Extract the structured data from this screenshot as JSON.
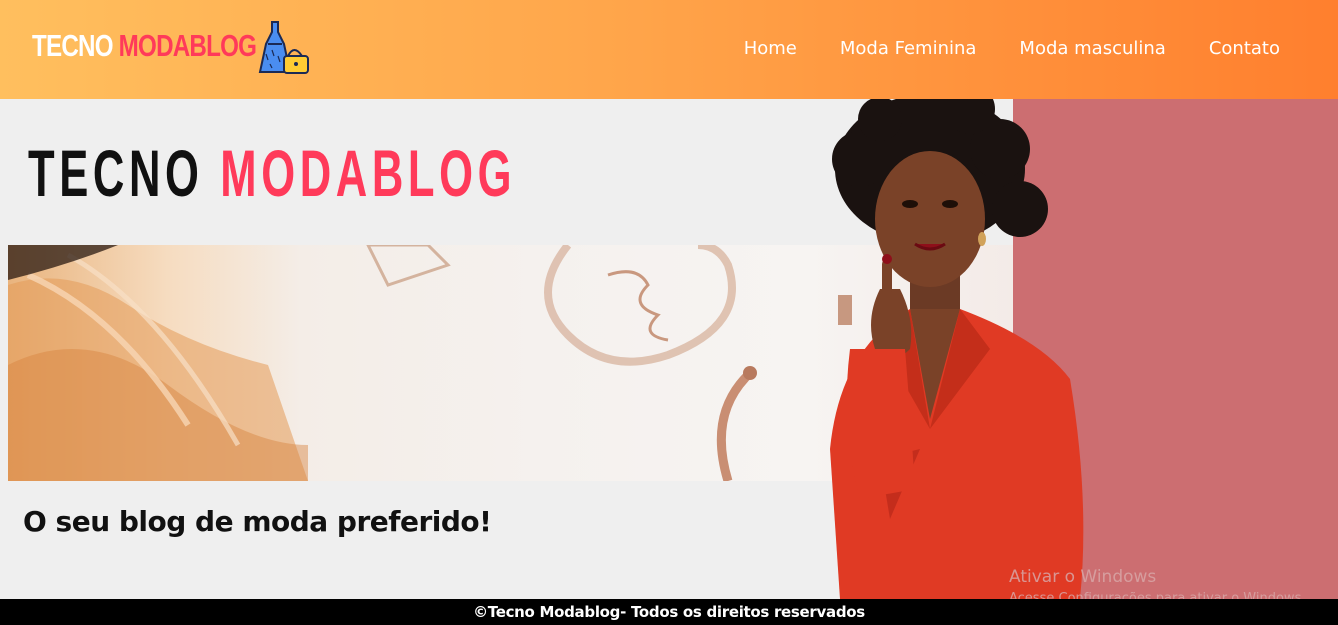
{
  "header": {
    "logo": {
      "part1": "TECNO",
      "part2": "MODABLOG",
      "icon": "dress-handbag-icon"
    },
    "nav": [
      {
        "label": "Home"
      },
      {
        "label": "Moda Feminina"
      },
      {
        "label": "Moda masculina"
      },
      {
        "label": "Contato"
      }
    ]
  },
  "hero": {
    "big_logo": {
      "part1": "TECNO",
      "part2": "MODABLOG"
    },
    "tagline": "O seu blog de moda preferido!"
  },
  "watermark": {
    "title": "Ativar o Windows",
    "subtitle": "Acesse Configurações para ativar o Windows."
  },
  "footer": {
    "text": "©Tecno Modablog- Todos os direitos reservados"
  },
  "colors": {
    "accent": "#ff3a5a",
    "header_start": "#ffbf5e",
    "header_end": "#ff7f2e",
    "panel": "#cc6e71",
    "footer_bg": "#000000"
  }
}
